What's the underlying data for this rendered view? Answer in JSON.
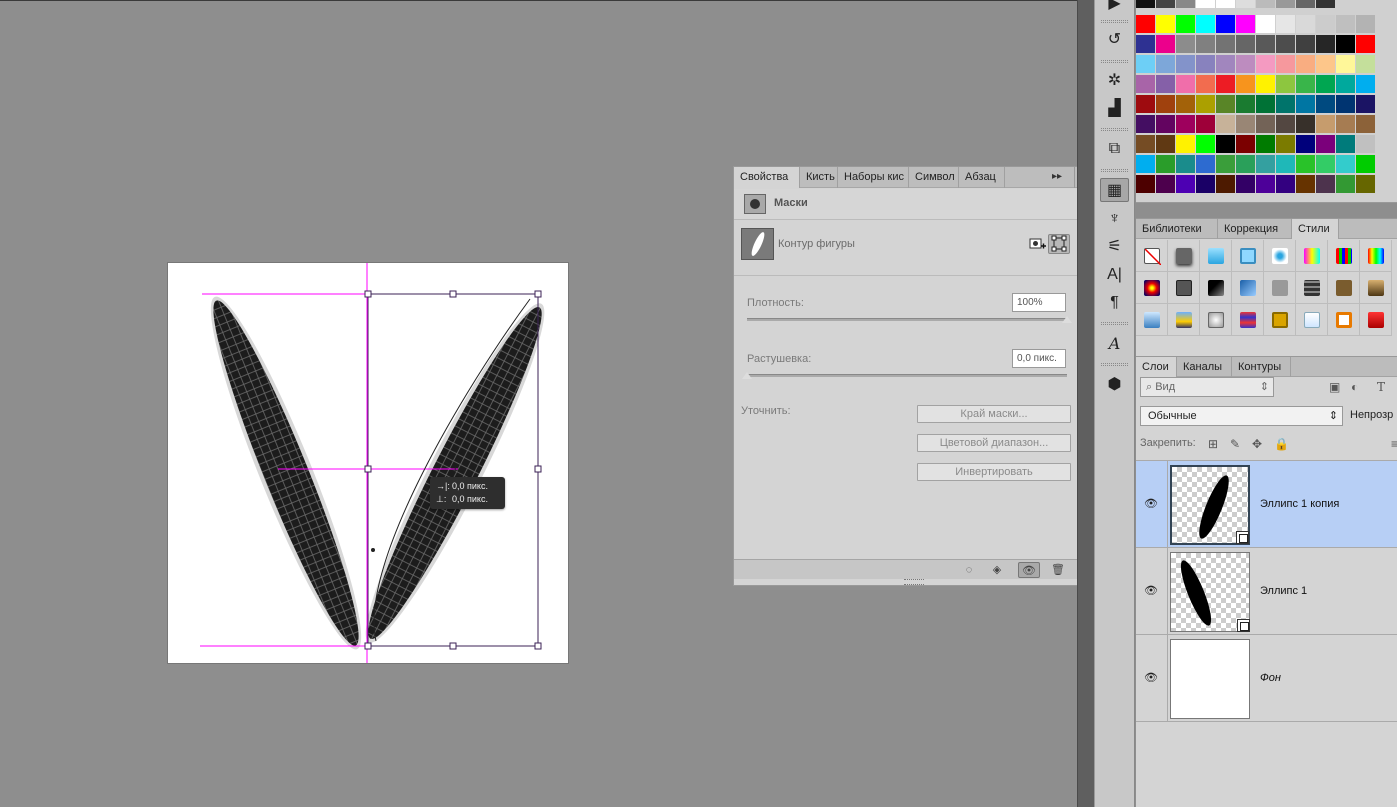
{
  "canvas": {
    "tooltip_line1": "0,0 пикс.",
    "tooltip_line2": "0,0 пикс."
  },
  "properties_panel": {
    "tabs": [
      "Свойства",
      "Кисть",
      "Наборы кис",
      "Символ",
      "Абзац"
    ],
    "active_tab": "Свойства",
    "section_title": "Маски",
    "shape_label": "Контур фигуры",
    "density_label": "Плотность:",
    "density_value": "100%",
    "density_level": 1.0,
    "feather_label": "Растушевка:",
    "feather_value": "0,0 пикс.",
    "feather_level": 0.0,
    "refine_label": "Уточнить:",
    "buttons": {
      "mask_edge": "Край маски...",
      "color_range": "Цветовой диапазон...",
      "invert": "Инвертировать"
    }
  },
  "swatches": {
    "rows": [
      [
        "#ff0000",
        "#ffff00",
        "#00ff00",
        "#00ffff",
        "#0000ff",
        "#ff00ff",
        "#ffffff",
        "#e6e6e6",
        "#d9d9d9",
        "#cccccc",
        "#bfbfbf",
        "#b3b3b3"
      ],
      [
        "#2e3192",
        "#ec008c",
        "#8c8c8c",
        "#808080",
        "#737373",
        "#666666",
        "#595959",
        "#4d4d4d",
        "#404040",
        "#262626",
        "#000000",
        "#ff0000"
      ],
      [
        "#6dcff6",
        "#7da7d9",
        "#8393ca",
        "#8882be",
        "#a186be",
        "#bd8cbf",
        "#f49ac1",
        "#f6989d",
        "#f9ad81",
        "#fdc68a",
        "#fff799",
        "#c4df9b"
      ],
      [
        "#a864a8",
        "#8560a8",
        "#f06eaa",
        "#f26c4f",
        "#ed1c24",
        "#f7941d",
        "#fff200",
        "#8dc63f",
        "#39b54a",
        "#00a651",
        "#00a99d",
        "#00aeef"
      ],
      [
        "#9e0b0f",
        "#a0410d",
        "#a36209",
        "#aba000",
        "#598527",
        "#1a7b30",
        "#007236",
        "#00746b",
        "#0076a3",
        "#004a80",
        "#003471",
        "#1b1464"
      ],
      [
        "#440e62",
        "#630460",
        "#9e005d",
        "#9e0039",
        "#c7b299",
        "#998675",
        "#736357",
        "#534741",
        "#37302a",
        "#c69c6d",
        "#a67c52",
        "#8c6239"
      ],
      [
        "#754c24",
        "#603913",
        "#fff200",
        "#00ff00",
        "#000000",
        "#7b0000",
        "#007b00",
        "#7b7b00",
        "#00007b",
        "#7b007b",
        "#007b7b",
        "#c0c0c0"
      ],
      [
        "#00aeef",
        "#2a9d2a",
        "#1a8c8c",
        "#2d6bd0",
        "#3a9e3a",
        "#2aa05a",
        "#34a0a0",
        "#1fb8b8",
        "#29c229",
        "#33cc66",
        "#33cccc",
        "#00cc00"
      ],
      [
        "#4d0000",
        "#4d004d",
        "#4d00b3",
        "#1a0066",
        "#4d1a00",
        "#330066",
        "#4d0099",
        "#330080",
        "#663300",
        "#4d334d",
        "#339933",
        "#666600"
      ]
    ]
  },
  "styles_panel": {
    "tabs": [
      "Библиотеки",
      "Коррекция",
      "Стили"
    ],
    "active_tab": "Стили"
  },
  "layers_panel": {
    "tabs": [
      "Слои",
      "Каналы",
      "Контуры"
    ],
    "active_tab": "Слои",
    "filter_placeholder": "Вид",
    "blend_mode": "Обычные",
    "opacity_label": "Непрозр",
    "lock_label": "Закрепить:",
    "layers": [
      {
        "name": "Эллипс 1 копия",
        "visible": true,
        "selected": true
      },
      {
        "name": "Эллипс 1",
        "visible": true,
        "selected": false
      },
      {
        "name": "Фон",
        "visible": true,
        "selected": false
      }
    ]
  },
  "colors": {
    "guide": "#ff00ff",
    "selection": "#b7cff5",
    "workspace": "#8e8e8e"
  }
}
